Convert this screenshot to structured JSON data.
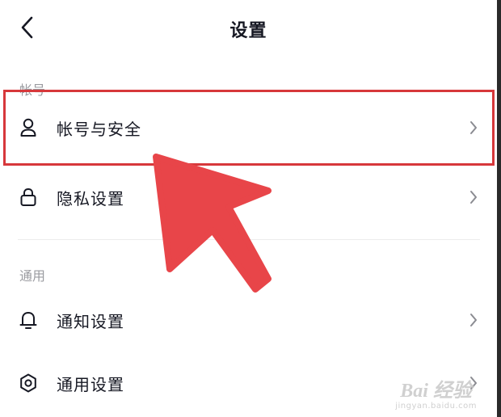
{
  "header": {
    "title": "设置",
    "back_icon": "chevron-left-icon"
  },
  "sections": [
    {
      "label": "帐号",
      "items": [
        {
          "label": "帐号与安全",
          "icon": "user-icon",
          "highlighted": true
        },
        {
          "label": "隐私设置",
          "icon": "lock-icon"
        }
      ]
    },
    {
      "label": "通用",
      "items": [
        {
          "label": "通知设置",
          "icon": "bell-icon"
        },
        {
          "label": "通用设置",
          "icon": "gear-icon"
        }
      ]
    }
  ],
  "annotation": {
    "highlight_color": "#d7383b",
    "arrow_color": "#e84549"
  },
  "watermark": {
    "main": "Bai 经验",
    "sub": "jingyan.baidu.com"
  },
  "colors": {
    "text": "#161823",
    "muted": "#9a9ba0",
    "chevron": "#8a8b91"
  }
}
